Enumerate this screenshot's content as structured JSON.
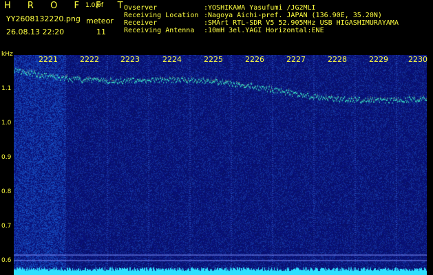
{
  "header": {
    "brand": "H R O F F T",
    "version": "1.0.0f",
    "filename": "YY2608132220.png",
    "meteor_label": "meteor",
    "datetime": "26.08.13 22:20",
    "meteor_count": "11"
  },
  "info": [
    {
      "key": "Ovserver",
      "value": ":YOSHIKAWA Yasufumi /JG2MLI"
    },
    {
      "key": "Receiving Location",
      "value": ":Nagoya Aichi-pref. JAPAN (136.90E, 35.20N)"
    },
    {
      "key": "Receiver",
      "value": ":SMArt RTL-SDR V5 52.905MHz USB HIGASHIMURAYAMA"
    },
    {
      "key": "Receiving Antenna",
      "value": ":10mH 3el.YAGI Horizontal:ENE"
    }
  ],
  "axis": {
    "unit": "kHz",
    "y_ticks": [
      "1.1",
      "1.0",
      "0.9",
      "0.8",
      "0.7",
      "0.6"
    ],
    "time_ticks": [
      "2221",
      "2222",
      "2223",
      "2224",
      "2225",
      "2226",
      "2227",
      "2228",
      "2229",
      "2230"
    ]
  },
  "colors": {
    "text": "#ffff40",
    "background": "#000000",
    "noise": "#1a2ea0",
    "trace": "#40ffd0"
  }
}
